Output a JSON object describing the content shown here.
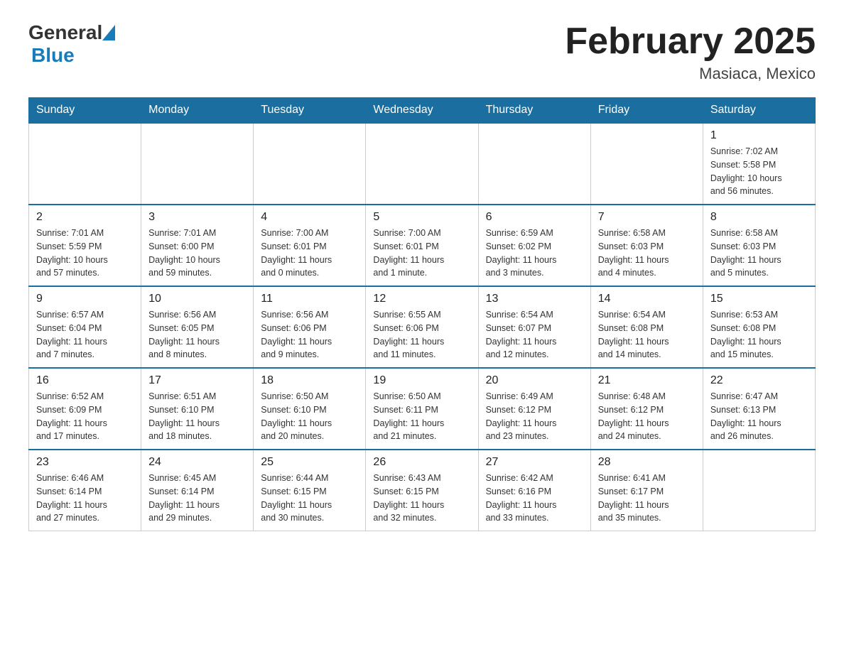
{
  "header": {
    "logo_general": "General",
    "logo_blue": "Blue",
    "month_title": "February 2025",
    "location": "Masiaca, Mexico"
  },
  "days_of_week": [
    "Sunday",
    "Monday",
    "Tuesday",
    "Wednesday",
    "Thursday",
    "Friday",
    "Saturday"
  ],
  "weeks": [
    [
      {
        "day": "",
        "info": ""
      },
      {
        "day": "",
        "info": ""
      },
      {
        "day": "",
        "info": ""
      },
      {
        "day": "",
        "info": ""
      },
      {
        "day": "",
        "info": ""
      },
      {
        "day": "",
        "info": ""
      },
      {
        "day": "1",
        "info": "Sunrise: 7:02 AM\nSunset: 5:58 PM\nDaylight: 10 hours\nand 56 minutes."
      }
    ],
    [
      {
        "day": "2",
        "info": "Sunrise: 7:01 AM\nSunset: 5:59 PM\nDaylight: 10 hours\nand 57 minutes."
      },
      {
        "day": "3",
        "info": "Sunrise: 7:01 AM\nSunset: 6:00 PM\nDaylight: 10 hours\nand 59 minutes."
      },
      {
        "day": "4",
        "info": "Sunrise: 7:00 AM\nSunset: 6:01 PM\nDaylight: 11 hours\nand 0 minutes."
      },
      {
        "day": "5",
        "info": "Sunrise: 7:00 AM\nSunset: 6:01 PM\nDaylight: 11 hours\nand 1 minute."
      },
      {
        "day": "6",
        "info": "Sunrise: 6:59 AM\nSunset: 6:02 PM\nDaylight: 11 hours\nand 3 minutes."
      },
      {
        "day": "7",
        "info": "Sunrise: 6:58 AM\nSunset: 6:03 PM\nDaylight: 11 hours\nand 4 minutes."
      },
      {
        "day": "8",
        "info": "Sunrise: 6:58 AM\nSunset: 6:03 PM\nDaylight: 11 hours\nand 5 minutes."
      }
    ],
    [
      {
        "day": "9",
        "info": "Sunrise: 6:57 AM\nSunset: 6:04 PM\nDaylight: 11 hours\nand 7 minutes."
      },
      {
        "day": "10",
        "info": "Sunrise: 6:56 AM\nSunset: 6:05 PM\nDaylight: 11 hours\nand 8 minutes."
      },
      {
        "day": "11",
        "info": "Sunrise: 6:56 AM\nSunset: 6:06 PM\nDaylight: 11 hours\nand 9 minutes."
      },
      {
        "day": "12",
        "info": "Sunrise: 6:55 AM\nSunset: 6:06 PM\nDaylight: 11 hours\nand 11 minutes."
      },
      {
        "day": "13",
        "info": "Sunrise: 6:54 AM\nSunset: 6:07 PM\nDaylight: 11 hours\nand 12 minutes."
      },
      {
        "day": "14",
        "info": "Sunrise: 6:54 AM\nSunset: 6:08 PM\nDaylight: 11 hours\nand 14 minutes."
      },
      {
        "day": "15",
        "info": "Sunrise: 6:53 AM\nSunset: 6:08 PM\nDaylight: 11 hours\nand 15 minutes."
      }
    ],
    [
      {
        "day": "16",
        "info": "Sunrise: 6:52 AM\nSunset: 6:09 PM\nDaylight: 11 hours\nand 17 minutes."
      },
      {
        "day": "17",
        "info": "Sunrise: 6:51 AM\nSunset: 6:10 PM\nDaylight: 11 hours\nand 18 minutes."
      },
      {
        "day": "18",
        "info": "Sunrise: 6:50 AM\nSunset: 6:10 PM\nDaylight: 11 hours\nand 20 minutes."
      },
      {
        "day": "19",
        "info": "Sunrise: 6:50 AM\nSunset: 6:11 PM\nDaylight: 11 hours\nand 21 minutes."
      },
      {
        "day": "20",
        "info": "Sunrise: 6:49 AM\nSunset: 6:12 PM\nDaylight: 11 hours\nand 23 minutes."
      },
      {
        "day": "21",
        "info": "Sunrise: 6:48 AM\nSunset: 6:12 PM\nDaylight: 11 hours\nand 24 minutes."
      },
      {
        "day": "22",
        "info": "Sunrise: 6:47 AM\nSunset: 6:13 PM\nDaylight: 11 hours\nand 26 minutes."
      }
    ],
    [
      {
        "day": "23",
        "info": "Sunrise: 6:46 AM\nSunset: 6:14 PM\nDaylight: 11 hours\nand 27 minutes."
      },
      {
        "day": "24",
        "info": "Sunrise: 6:45 AM\nSunset: 6:14 PM\nDaylight: 11 hours\nand 29 minutes."
      },
      {
        "day": "25",
        "info": "Sunrise: 6:44 AM\nSunset: 6:15 PM\nDaylight: 11 hours\nand 30 minutes."
      },
      {
        "day": "26",
        "info": "Sunrise: 6:43 AM\nSunset: 6:15 PM\nDaylight: 11 hours\nand 32 minutes."
      },
      {
        "day": "27",
        "info": "Sunrise: 6:42 AM\nSunset: 6:16 PM\nDaylight: 11 hours\nand 33 minutes."
      },
      {
        "day": "28",
        "info": "Sunrise: 6:41 AM\nSunset: 6:17 PM\nDaylight: 11 hours\nand 35 minutes."
      },
      {
        "day": "",
        "info": ""
      }
    ]
  ]
}
